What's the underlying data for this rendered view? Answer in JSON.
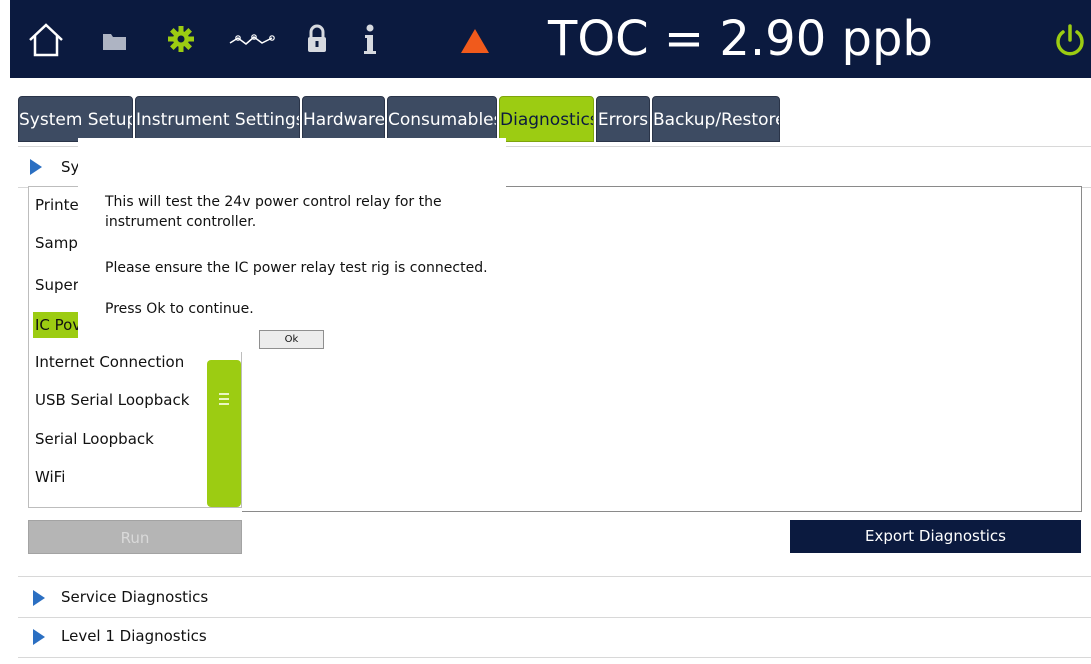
{
  "header": {
    "toc_reading": "TOC = 2.90 ppb",
    "icons": [
      "home-icon",
      "folder-icon",
      "gear-icon",
      "trend-icon",
      "lock-icon",
      "info-icon",
      "alarm-icon",
      "power-icon"
    ],
    "accent_green": "#9ccc12",
    "alarm_color": "#f05a1c",
    "bar_color": "#0b1a3f"
  },
  "tabs": [
    {
      "label": "System Setup",
      "active": false
    },
    {
      "label": "Instrument Settings",
      "active": false
    },
    {
      "label": "Hardware",
      "active": false
    },
    {
      "label": "Consumables",
      "active": false
    },
    {
      "label": "Diagnostics",
      "active": true
    },
    {
      "label": "Errors",
      "active": false
    },
    {
      "label": "Backup/Restore",
      "active": false
    }
  ],
  "system_section": {
    "label_visible": "Sy",
    "items": [
      {
        "label": "Printer",
        "selected": false
      },
      {
        "label": "Sampl",
        "selected": false
      },
      {
        "label": "Super",
        "selected": false
      },
      {
        "label": "IC Pov",
        "selected": true
      },
      {
        "label": "Internet Connection",
        "selected": false
      },
      {
        "label": "USB Serial Loopback",
        "selected": false
      },
      {
        "label": "Serial Loopback",
        "selected": false
      },
      {
        "label": "WiFi",
        "selected": false
      }
    ],
    "run_label": "Run",
    "export_label": "Export Diagnostics"
  },
  "sections": [
    {
      "label": "Service Diagnostics"
    },
    {
      "label": "Level 1 Diagnostics"
    }
  ],
  "dialog": {
    "line1": "This will test the 24v power control relay for the",
    "line2": "instrument controller.",
    "line3": "Please ensure the IC power relay test rig is connected.",
    "line4": "Press Ok to continue.",
    "ok_label": "Ok"
  }
}
